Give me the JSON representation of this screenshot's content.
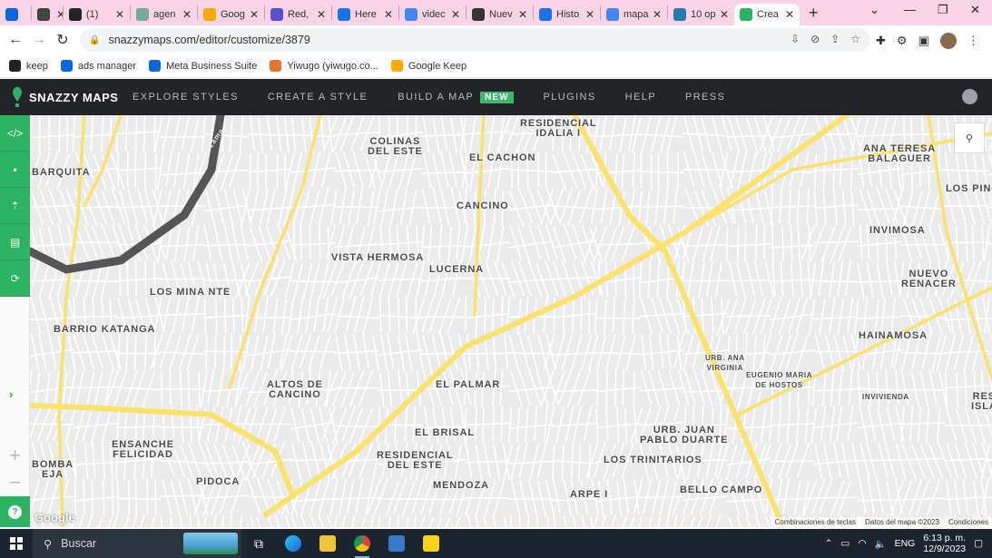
{
  "browser": {
    "tabs": [
      {
        "title": "",
        "icon": "meta-icon",
        "color": "#0668e1"
      },
      {
        "title": "",
        "icon": "window-icon",
        "color": "#444444"
      },
      {
        "title": "(1)",
        "icon": "cap-icon",
        "color": "#222222"
      },
      {
        "title": "agen",
        "icon": "openai-icon",
        "color": "#74aa9c"
      },
      {
        "title": "Goog",
        "icon": "keep-icon",
        "color": "#f9ab00"
      },
      {
        "title": "Red, ",
        "icon": "form-icon",
        "color": "#5a4fcf"
      },
      {
        "title": "Here",
        "icon": "bing-icon",
        "color": "#1a73e8"
      },
      {
        "title": "videc",
        "icon": "google-icon",
        "color": "#4285f4"
      },
      {
        "title": "Nuev",
        "icon": "github-icon",
        "color": "#333333"
      },
      {
        "title": "Histo",
        "icon": "history-icon",
        "color": "#1a73e8"
      },
      {
        "title": "mapa",
        "icon": "google-icon",
        "color": "#4285f4"
      },
      {
        "title": "10 op",
        "icon": "m-icon",
        "color": "#2a7ab0"
      },
      {
        "title": "Crea",
        "icon": "snazzy-pin-icon",
        "color": "#2cb462"
      }
    ],
    "url": "snazzymaps.com/editor/customize/3879",
    "bookmarks": [
      {
        "label": "keep",
        "icon": "github-icon",
        "color": "#222222"
      },
      {
        "label": "ads manager",
        "icon": "meta-icon",
        "color": "#0668e1"
      },
      {
        "label": "Meta Business Suite",
        "icon": "meta-icon",
        "color": "#0668e1"
      },
      {
        "label": "Yiwugo (yiwugo.co...",
        "icon": "yiwugo-icon",
        "color": "#e8732c"
      },
      {
        "label": "Google Keep",
        "icon": "keep-icon",
        "color": "#f9ab00"
      }
    ]
  },
  "snazzy": {
    "brand": "SNAZZY MAPS",
    "nav": [
      "EXPLORE STYLES",
      "CREATE A STYLE",
      "BUILD A MAP",
      "PLUGINS",
      "HELP",
      "PRESS"
    ],
    "new_badge": "NEW",
    "accent": "#2cb462"
  },
  "map": {
    "labels": [
      {
        "text": "RESIDENCIAL\nIDALIA I"
      },
      {
        "text": "COLINAS\nDEL ESTE"
      },
      {
        "text": "EL CACHON"
      },
      {
        "text": "ANA TERESA\nBALAGUER"
      },
      {
        "text": "BARQUITA"
      },
      {
        "text": "LOS PINOS"
      },
      {
        "text": "CANCINO"
      },
      {
        "text": "INVIMOSA"
      },
      {
        "text": "VISTA HERMOSA"
      },
      {
        "text": "LUCERNA"
      },
      {
        "text": "NUEVO\nRENACER"
      },
      {
        "text": "LOS MINA NTE"
      },
      {
        "text": "BARRIO KATANGA"
      },
      {
        "text": "HAINAMOSA"
      },
      {
        "text": "URB. ANA\nVIRGINIA"
      },
      {
        "text": "EUGENIO MARIA\nDE HOSTOS"
      },
      {
        "text": "ALTOS DE\nCANCINO"
      },
      {
        "text": "EL PALMAR"
      },
      {
        "text": "INVIVIENDA"
      },
      {
        "text": "RES\nISLA"
      },
      {
        "text": "EL BRISAL"
      },
      {
        "text": "URB. JUAN\nPABLO DUARTE"
      },
      {
        "text": "ENSANCHE\nFELICIDAD"
      },
      {
        "text": "RESIDENCIAL\nDEL ESTE"
      },
      {
        "text": "LOS TRINITARIOS"
      },
      {
        "text": "BOMBA\nEJA"
      },
      {
        "text": "PIDOCA"
      },
      {
        "text": "MENDOZA"
      },
      {
        "text": "ARPE I"
      },
      {
        "text": "BELLO CAMPO"
      },
      {
        "text": "Rio Ozama"
      }
    ],
    "google_logo": "Google",
    "attribution": [
      "Combinaciones de teclas",
      "Datos del mapa ©2023",
      "Condiciones"
    ],
    "road_color": "#fbe26b",
    "river_color": "#555555"
  },
  "taskbar": {
    "search_placeholder": "Buscar",
    "language": "ENG",
    "time": "6:13 p. m.",
    "date": "12/9/2023"
  }
}
